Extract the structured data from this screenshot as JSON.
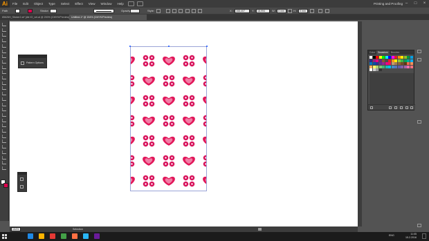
{
  "app": {
    "logo": "Ai",
    "menu": [
      "File",
      "Edit",
      "Object",
      "Type",
      "Select",
      "Effect",
      "View",
      "Window",
      "Help"
    ],
    "workspace": "Printing and Proofing",
    "window_buttons": [
      "–",
      "□",
      "×"
    ]
  },
  "control_bar": {
    "selection_label": "Path",
    "stroke_label": "Stroke:",
    "opacity_label": "Opacity:",
    "style_label": "Style:",
    "x_label": "X:",
    "x_value": "168,407 mm",
    "y_label": "Y:",
    "y_value": "18,994 mm",
    "w_label": "W:",
    "w_value": "0 mm",
    "h_label": "H:",
    "h_value": "0 mm"
  },
  "tabs": [
    {
      "label": "85626H_Sticker2.ai* [die IO_vet.ai @ 200% (CMYK/Preview)]",
      "active": false
    },
    {
      "label": "Untitled-1* @ 154% (CMYK/Preview)",
      "active": true
    }
  ],
  "pattern_panel": {
    "title": "Pattern Options"
  },
  "swatches_panel": {
    "tabs": [
      "Color",
      "Swatches",
      "Brushes"
    ],
    "active_tab": "Swatches",
    "colors": [
      "#ffffff",
      "#000000",
      "#ff0000",
      "#ffff00",
      "#00ff00",
      "#00ffff",
      "#0000ff",
      "#ff00ff",
      "#e31e24",
      "#f39200",
      "#ffed00",
      "#95c11f",
      "#009640",
      "#00a0e3",
      "#312783",
      "#951b81",
      "#e6007e",
      "#662483",
      "#8b572a",
      "#4a4a4a",
      "#ed1c24",
      "#f7941d",
      "#fff200",
      "#8dc63f",
      "#39b54a",
      "#00a651",
      "#00a99d",
      "#00aeef",
      "#0072bc",
      "#0054a6",
      "#2e3192",
      "#662d91",
      "#92278f",
      "#ec008c",
      "#ed145b",
      "#c69c6d",
      "#a67c52",
      "#8c6239",
      "#754c24",
      "#603913",
      "#f26c4f",
      "#f68e56",
      "#fbaf5d",
      "#fff568",
      "#acd373",
      "#7cc576",
      "#3bb878",
      "#1abbb4",
      "#00bff3",
      "#448ccb",
      "#5674b9",
      "#605ca8",
      "#8560a8",
      "#a864a8",
      "#f06eaa",
      "#f26d7d",
      "#ffffff",
      "#cccccc",
      "#999999",
      "#333333"
    ]
  },
  "artboard": {
    "pattern_colors": {
      "heart_dark": "#e2175a",
      "heart_light": "#f07fa6",
      "flower": "#d8105a",
      "flower_center": "#ffffff"
    }
  },
  "status_bar": {
    "zoom": "154%",
    "tool": "Selection"
  },
  "taskbar": {
    "time": "11:05",
    "date": "15.2.2016",
    "lang": "ENG",
    "apps": [
      "#1e88e5",
      "#ffb300",
      "#e53935",
      "#43a047",
      "#ff7043",
      "#29b6f6",
      "#6a1b9a"
    ]
  }
}
